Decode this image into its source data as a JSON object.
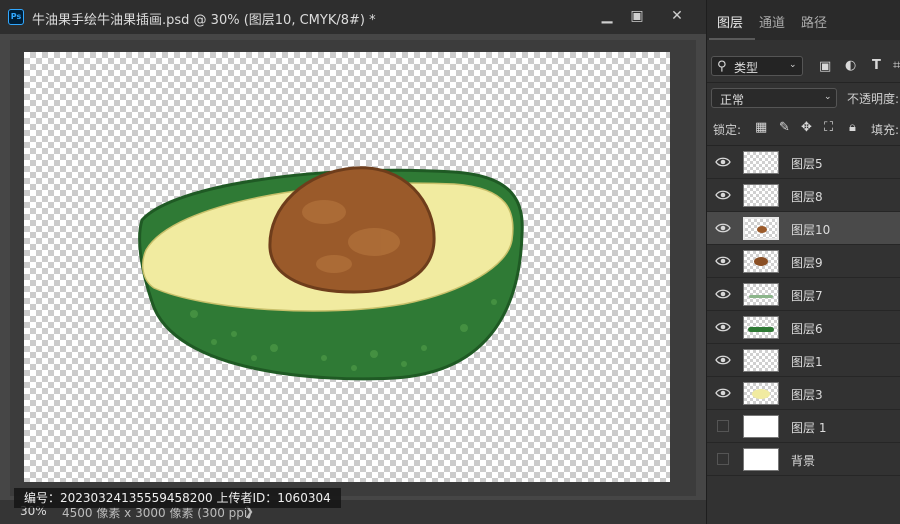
{
  "document": {
    "app_icon": "Ps",
    "title": "牛油果手绘牛油果插画.psd @ 30% (图层10, CMYK/8#) *",
    "window_buttons": [
      "minimize-icon",
      "maximize-icon",
      "close-icon"
    ],
    "zoom": "30%",
    "doc_size": "4500 像素 x 3000 像素 (300 ppi)",
    "status_arrow": "❯",
    "watermark": "编号：20230324135559458200  上传者ID：1060304"
  },
  "panel": {
    "tabs": [
      {
        "label": "图层",
        "active": true
      },
      {
        "label": "通道",
        "active": false
      },
      {
        "label": "路径",
        "active": false
      }
    ],
    "filter": {
      "label": "类型",
      "icons": [
        "search-icon",
        "image-filter-icon",
        "adjustment-filter-icon",
        "type-filter-icon",
        "shape-filter-icon"
      ]
    },
    "blend_mode": "正常",
    "opacity_label": "不透明度:",
    "lock_label": "锁定:",
    "fill_label": "填充:",
    "layers": [
      {
        "name": "图层5",
        "visible": true,
        "selected": false,
        "thumb": "checker"
      },
      {
        "name": "图层8",
        "visible": true,
        "selected": false,
        "thumb": "checker"
      },
      {
        "name": "图层10",
        "visible": true,
        "selected": true,
        "thumb": "checker"
      },
      {
        "name": "图层9",
        "visible": true,
        "selected": false,
        "thumb": "checker"
      },
      {
        "name": "图层7",
        "visible": true,
        "selected": false,
        "thumb": "checker"
      },
      {
        "name": "图层6",
        "visible": true,
        "selected": false,
        "thumb": "checker"
      },
      {
        "name": "图层1",
        "visible": true,
        "selected": false,
        "thumb": "checker"
      },
      {
        "name": "图层3",
        "visible": true,
        "selected": false,
        "thumb": "checker"
      },
      {
        "name": "图层 1",
        "visible": false,
        "selected": false,
        "thumb": "white"
      },
      {
        "name": "背景",
        "visible": false,
        "selected": false,
        "thumb": "white"
      }
    ]
  },
  "colors": {
    "avocado_skin": "#2f7a35",
    "avocado_flesh": "#f1eba0",
    "avocado_seed": "#9a5a2a"
  }
}
